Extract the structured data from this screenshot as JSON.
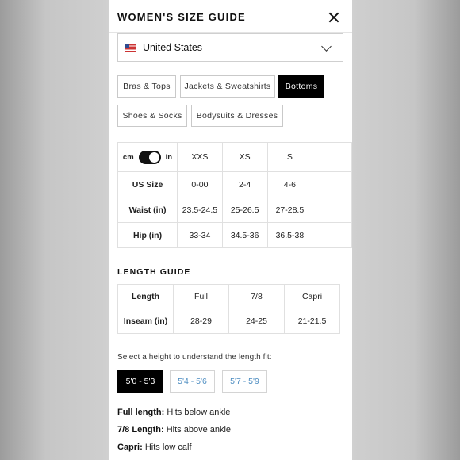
{
  "header": {
    "title": "WOMEN'S SIZE GUIDE"
  },
  "country": {
    "selected": "United States"
  },
  "categories": [
    {
      "label": "Bras & Tops",
      "active": false
    },
    {
      "label": "Jackets & Sweatshirts",
      "active": false
    },
    {
      "label": "Bottoms",
      "active": true
    },
    {
      "label": "Shoes & Socks",
      "active": false
    },
    {
      "label": "Bodysuits & Dresses",
      "active": false
    }
  ],
  "size_table": {
    "unit_left": "cm",
    "unit_right": "in",
    "unit_selected": "in",
    "columns": [
      "XXS",
      "XS",
      "S"
    ],
    "rows": [
      {
        "label": "US Size",
        "values": [
          "0-00",
          "2-4",
          "4-6"
        ]
      },
      {
        "label": "Waist (in)",
        "values": [
          "23.5-24.5",
          "25-26.5",
          "27-28.5"
        ]
      },
      {
        "label": "Hip (in)",
        "values": [
          "33-34",
          "34.5-36",
          "36.5-38"
        ]
      }
    ]
  },
  "length_guide": {
    "title": "LENGTH GUIDE",
    "header_label": "Length",
    "columns": [
      "Full",
      "7/8",
      "Capri"
    ],
    "row_label": "Inseam (in)",
    "values": [
      "28-29",
      "24-25",
      "21-21.5"
    ]
  },
  "height_prompt": "Select a height to understand the length fit:",
  "height_options": [
    {
      "label": "5'0 - 5'3",
      "active": true
    },
    {
      "label": "5'4 - 5'6",
      "active": false
    },
    {
      "label": "5'7 - 5'9",
      "active": false
    }
  ],
  "fit_notes": [
    {
      "label": "Full length:",
      "text": " Hits below ankle"
    },
    {
      "label": "7/8 Length:",
      "text": " Hits above ankle"
    },
    {
      "label": "Capri:",
      "text": " Hits low calf"
    }
  ]
}
